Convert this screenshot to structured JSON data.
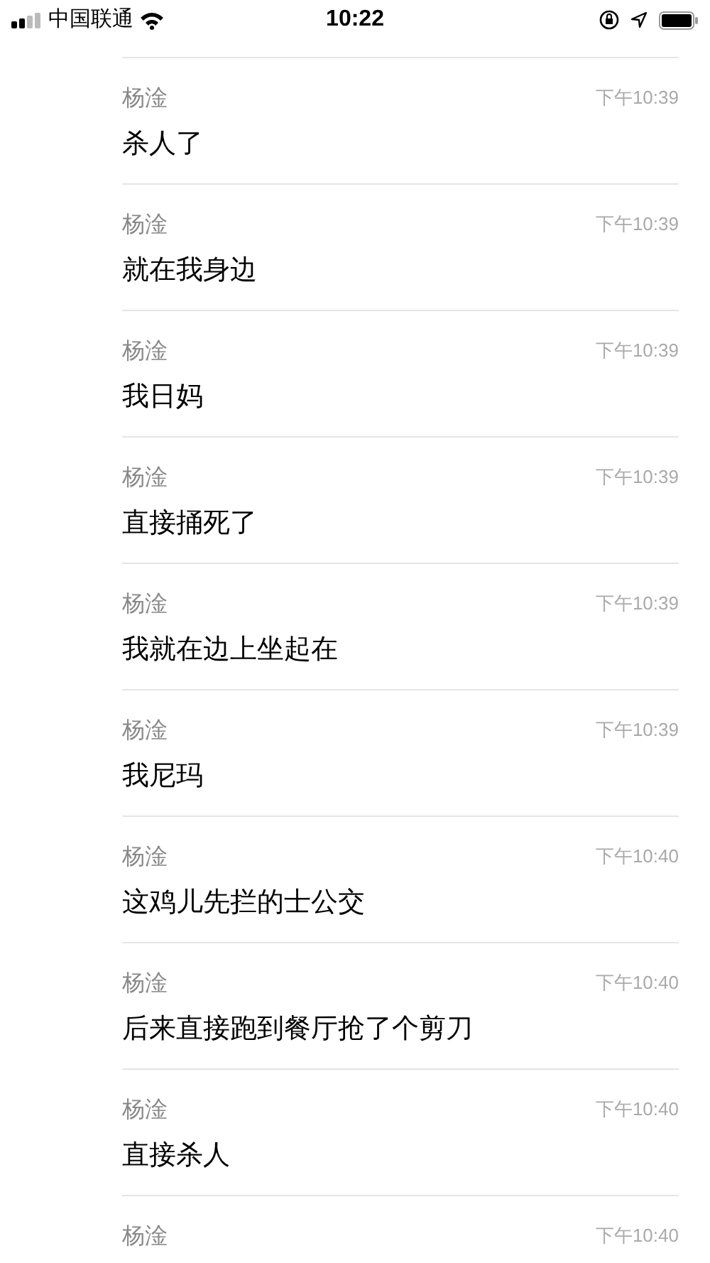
{
  "status_bar": {
    "carrier": "中国联通",
    "time": "10:22"
  },
  "messages": [
    {
      "sender": "杨淦",
      "time": "下午10:39",
      "text": "杀人了"
    },
    {
      "sender": "杨淦",
      "time": "下午10:39",
      "text": "就在我身边"
    },
    {
      "sender": "杨淦",
      "time": "下午10:39",
      "text": "我日妈"
    },
    {
      "sender": "杨淦",
      "time": "下午10:39",
      "text": "直接捅死了"
    },
    {
      "sender": "杨淦",
      "time": "下午10:39",
      "text": "我就在边上坐起在"
    },
    {
      "sender": "杨淦",
      "time": "下午10:39",
      "text": "我尼玛"
    },
    {
      "sender": "杨淦",
      "time": "下午10:40",
      "text": "这鸡儿先拦的士公交"
    },
    {
      "sender": "杨淦",
      "time": "下午10:40",
      "text": "后来直接跑到餐厅抢了个剪刀"
    },
    {
      "sender": "杨淦",
      "time": "下午10:40",
      "text": "直接杀人"
    },
    {
      "sender": "杨淦",
      "time": "下午10:40"
    }
  ]
}
